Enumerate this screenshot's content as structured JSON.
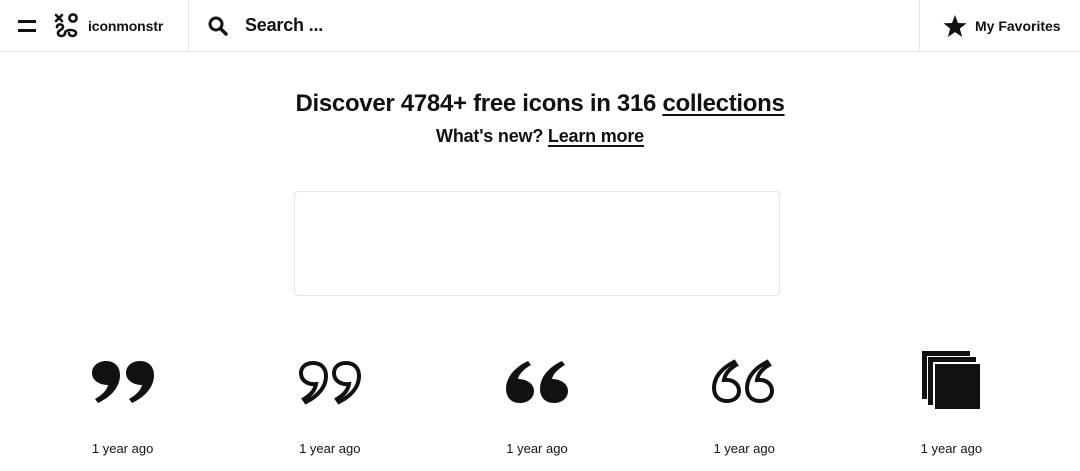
{
  "header": {
    "brand": "iconmonstr",
    "search_placeholder": "Search ...",
    "favorites_label": "My Favorites"
  },
  "hero": {
    "title_prefix": "Discover 4784+ free icons in 316 ",
    "title_link": "collections",
    "subtitle_prefix": "What's new? ",
    "subtitle_link": "Learn more"
  },
  "icons": [
    {
      "icon": "quote-close-filled-icon",
      "time": "1 year ago"
    },
    {
      "icon": "quote-close-outline-icon",
      "time": "1 year ago"
    },
    {
      "icon": "quote-open-filled-icon",
      "time": "1 year ago"
    },
    {
      "icon": "quote-open-outline-icon",
      "time": "1 year ago"
    },
    {
      "icon": "stacked-squares-icon",
      "time": "1 year ago"
    }
  ]
}
